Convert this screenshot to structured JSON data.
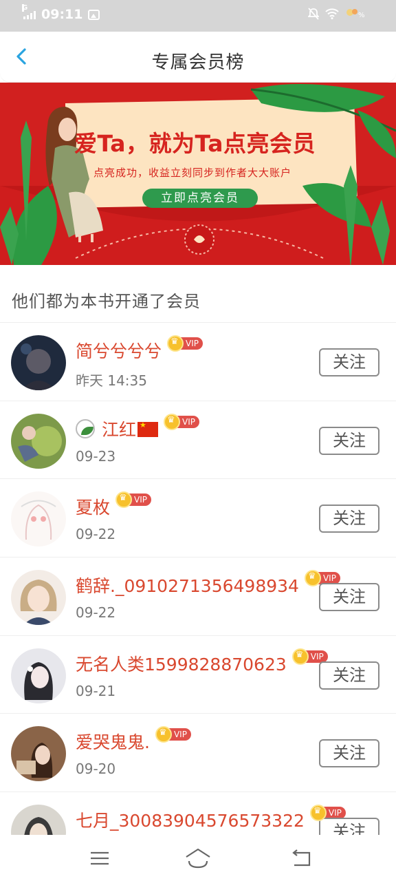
{
  "status_bar": {
    "time": "09:11",
    "signal_label": "G"
  },
  "header": {
    "title": "专属会员榜",
    "back_icon": "chevron-left-icon"
  },
  "banner": {
    "title": "爱Ta，就为Ta点亮会员",
    "subtitle": "点亮成功，收益立刻同步到作者大大账户",
    "button": "立即点亮会员",
    "colors": {
      "background": "#d1201f",
      "card": "#fde4c1",
      "button": "#2e9a4d"
    }
  },
  "section_title": "他们都为本书开通了会员",
  "members": [
    {
      "name": "简兮兮兮兮",
      "badge": "VIP",
      "date": "昨天 14:35",
      "follow": "关注"
    },
    {
      "name": "江红",
      "badge": "VIP",
      "date": "09-23",
      "follow": "关注",
      "prefix_icon": "leaf-icon",
      "suffix_icon": "china-flag-icon"
    },
    {
      "name": "夏枚",
      "badge": "VIP",
      "date": "09-22",
      "follow": "关注"
    },
    {
      "name": "鹤辞._0910271356498934",
      "badge": "VIP",
      "date": "09-22",
      "follow": "关注"
    },
    {
      "name": "无名人类1599828870623",
      "badge": "VIP",
      "date": "09-21",
      "follow": "关注"
    },
    {
      "name": "爱哭鬼鬼.",
      "badge": "VIP",
      "date": "09-20",
      "follow": "关注"
    },
    {
      "name": "七月_30083904576573322",
      "badge": "VIP",
      "date": "",
      "follow": "关注"
    }
  ],
  "nav": {
    "menu_icon": "menu-icon",
    "home_icon": "home-icon",
    "back_icon": "back-icon"
  },
  "accent_color": "#d9482f"
}
